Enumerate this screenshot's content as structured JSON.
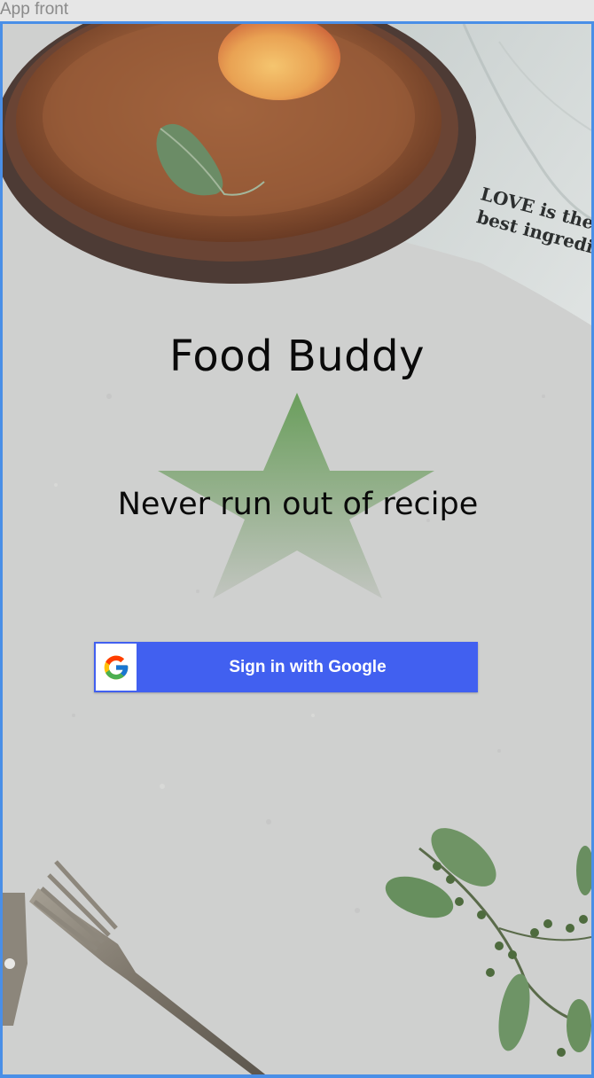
{
  "window": {
    "title": "App front"
  },
  "app": {
    "title": "Food Buddy",
    "tagline": "Never run out of recipe"
  },
  "decor": {
    "napkin_text_line1": "LOVE is the",
    "napkin_text_line2": "best ingredi"
  },
  "signin": {
    "label": "Sign in with Google",
    "icon": "google-g-icon"
  },
  "colors": {
    "window_border": "#4a8fe7",
    "button_background": "#4160f0",
    "star_top": "#6a9e5c",
    "star_bottom": "#c2c5c0"
  }
}
